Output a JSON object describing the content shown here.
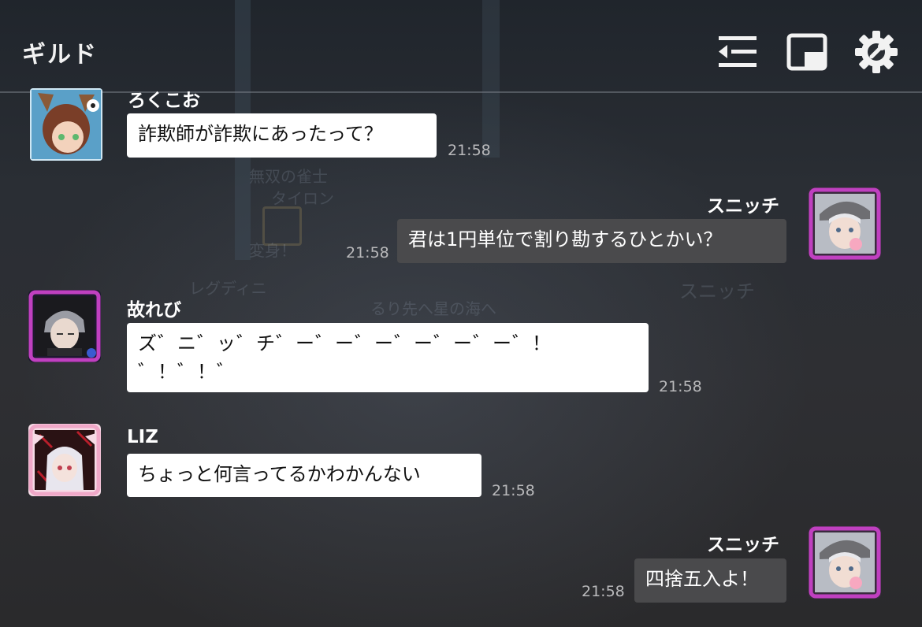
{
  "header": {
    "title": "ギルド",
    "icons": [
      "collapse-list-icon",
      "picture-in-picture-icon",
      "gear-icon"
    ]
  },
  "background_text": [
    "無双の雀士",
    "タイロン",
    "変身！",
    "レグディニ",
    "スニッチ",
    "るり先へ星の海へ"
  ],
  "messages": [
    {
      "side": "left",
      "name": "ろくこお",
      "text": "詐欺師が詐欺にあったって？",
      "time": "21:58"
    },
    {
      "side": "right",
      "name": "スニッチ",
      "text": "君は1円単位で割り勘するひとかい？",
      "time": "21:58"
    },
    {
      "side": "left",
      "name": "故れび",
      "text": "ズ゛ニ゛ッ゛チ゛ー゛ー゛ー゛ー゛ー゛ー゛！\n゛！゛！゛",
      "time": "21:58"
    },
    {
      "side": "left",
      "name": "LIZ",
      "text": "ちょっと何言ってるかわかんない",
      "time": "21:58"
    },
    {
      "side": "right",
      "name": "スニッチ",
      "text": "四捨五入よ！",
      "time": "21:58"
    }
  ],
  "colors": {
    "bubble_in": "#ffffff",
    "bubble_out": "#4a4a4c",
    "time": "#b9b9bb",
    "avatar_frame_snitch": "#c040c0",
    "avatar_frame_liz": "#f0a8c8"
  }
}
